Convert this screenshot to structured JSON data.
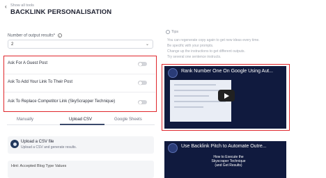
{
  "header": {
    "back_link": "Show all tools",
    "title": "BACKLINK PERSONALISATION"
  },
  "form": {
    "results_label": "Number of output results*",
    "results_value": "2",
    "toggles": [
      {
        "label": "Ask For A Guest Post",
        "on": false
      },
      {
        "label": "Ask To Add Your Link To Their Post",
        "on": false
      },
      {
        "label": "Ask To Replace Competitor Link (SkyScrapper Technique)",
        "on": false
      }
    ],
    "tabs": [
      {
        "label": "Manually",
        "active": false
      },
      {
        "label": "Upload CSV",
        "active": true
      },
      {
        "label": "Google Sheets",
        "active": false
      }
    ],
    "upload_title": "Upload a CSV file",
    "upload_desc": "Upload a CSV and generate results.",
    "hint": "Hint: Accepted Blog Type Values"
  },
  "tips": {
    "title": "Tips",
    "items": [
      "You can regenerate copy again to get new ideas every time.",
      "Be specific with your prompts.",
      "Change up the instructions to get different outputs.",
      "Try several one sentence instructs."
    ]
  },
  "videos": [
    {
      "title": "Rank Number One On Google Using Aut..."
    },
    {
      "title": "Use Backlink Pitch to Automate Outre...",
      "caption": "How to Execute the Skyscraper Technique (and Get Results)"
    }
  ],
  "colors": {
    "highlight": "#e0262b",
    "video_bg": "#101a3e",
    "tab_active": "#3b4a6b"
  }
}
